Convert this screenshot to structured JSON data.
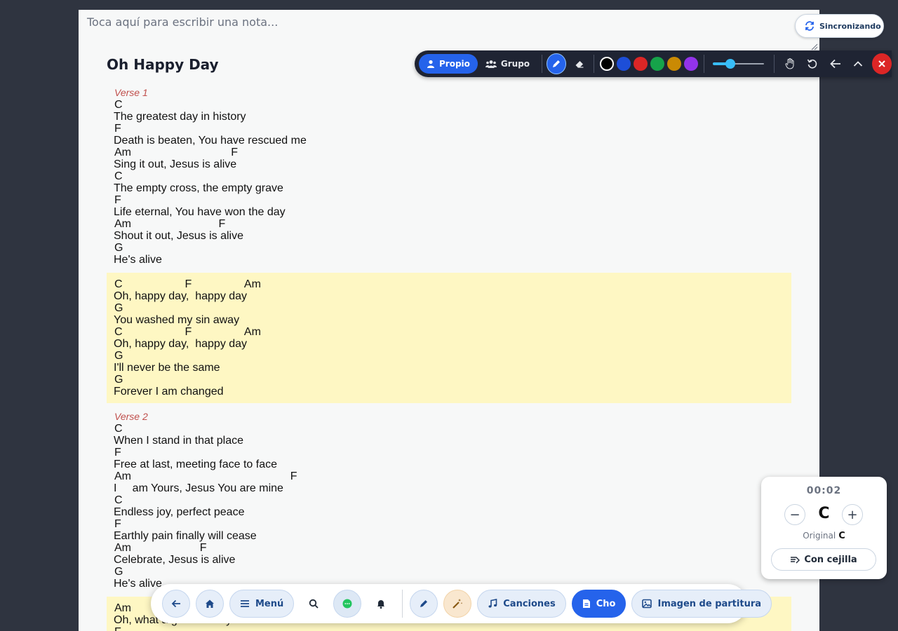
{
  "note": {
    "placeholder": "Toca aquí para escribir una nota..."
  },
  "song": {
    "title": "Oh Happy Day",
    "sections": [
      {
        "label": "Verse 1",
        "type": "verse",
        "pairs": [
          {
            "chords": "C",
            "lyric": "The greatest day in history"
          },
          {
            "chords": "F",
            "lyric": "Death is beaten, You have rescued me"
          },
          {
            "chords": "Am                                F",
            "lyric": "Sing it out, Jesus is alive"
          },
          {
            "chords": "C",
            "lyric": "The empty cross, the empty grave"
          },
          {
            "chords": "F",
            "lyric": "Life eternal, You have won the day"
          },
          {
            "chords": "Am                            F",
            "lyric": "Shout it out, Jesus is alive"
          },
          {
            "chords": "G",
            "lyric": "He's alive"
          }
        ]
      },
      {
        "label": "",
        "type": "chorus",
        "pairs": [
          {
            "chords": "C                    F                 Am",
            "lyric": "Oh, happy day,  happy day"
          },
          {
            "chords": "G",
            "lyric": "You washed my sin away"
          },
          {
            "chords": "C                    F                 Am",
            "lyric": "Oh, happy day,  happy day"
          },
          {
            "chords": "G",
            "lyric": "I'll never be the same"
          },
          {
            "chords": "G",
            "lyric": "Forever I am changed"
          }
        ]
      },
      {
        "label": "Verse 2",
        "type": "verse",
        "pairs": [
          {
            "chords": "C",
            "lyric": "When I stand in that place"
          },
          {
            "chords": "F",
            "lyric": "Free at last, meeting face to face"
          },
          {
            "chords": "Am                                                   F",
            "lyric": "I     am Yours, Jesus You are mine"
          },
          {
            "chords": "C",
            "lyric": "Endless joy, perfect peace"
          },
          {
            "chords": "F",
            "lyric": "Earthly pain finally will cease"
          },
          {
            "chords": "Am                      F",
            "lyric": "Celebrate, Jesus is alive"
          },
          {
            "chords": "G",
            "lyric": "He's alive"
          }
        ]
      },
      {
        "label": "",
        "type": "chorus",
        "pairs": [
          {
            "chords": "Am",
            "lyric": "Oh, what a glorious day"
          },
          {
            "chords": "F",
            "lyric": ""
          }
        ]
      }
    ]
  },
  "draw_toolbar": {
    "own_label": "Propio",
    "group_label": "Grupo",
    "colors": [
      "#000000",
      "#1d4ed8",
      "#dc2626",
      "#16a34a",
      "#ca8a04",
      "#9333ea"
    ],
    "selected_color": "#000000",
    "stroke_level": 0.35,
    "tools": [
      "pen-icon",
      "eraser-icon",
      "hand-icon",
      "undo-icon",
      "arrow-left-icon",
      "chevron-up-icon",
      "close-icon"
    ]
  },
  "sync": {
    "label": "Sincronizando"
  },
  "transpose": {
    "timer": "00:02",
    "key": "C",
    "original_label": "Original",
    "original_key": "C",
    "capo_label": "Con cejilla"
  },
  "bottom_nav": {
    "menu_label": "Menú",
    "songs_label": "Canciones",
    "cho_label": "Cho",
    "sheet_label": "Imagen de partitura"
  }
}
